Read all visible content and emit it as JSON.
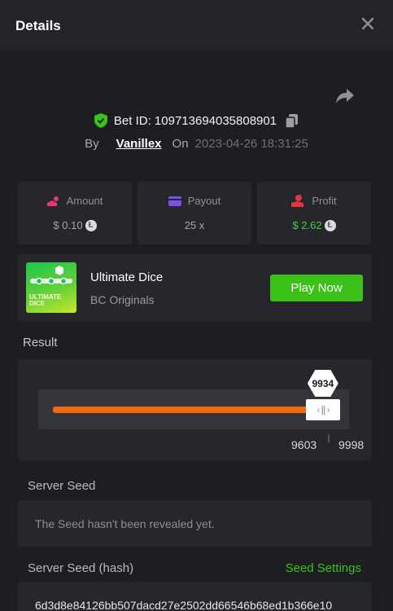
{
  "header": {
    "title": "Details"
  },
  "bet": {
    "id_label": "Bet ID:",
    "id_value": "109713694035808901",
    "by_label": "By",
    "username": "Vanillex",
    "on_label": "On",
    "timestamp": "2023-04-26 18:31:25"
  },
  "stats": {
    "amount": {
      "label": "Amount",
      "value": "$ 0.10",
      "icon": "amount-icon"
    },
    "payout": {
      "label": "Payout",
      "value": "25 x",
      "icon": "wallet-icon"
    },
    "profit": {
      "label": "Profit",
      "value": "$ 2.62",
      "icon": "profit-icon"
    }
  },
  "game": {
    "thumb_text": "ULTIMATE DICE",
    "name": "Ultimate Dice",
    "provider": "BC Originals",
    "play_label": "Play Now"
  },
  "result": {
    "label": "Result",
    "roll": "9934",
    "range_low": "9603",
    "range_high": "9998",
    "range_max": 10000,
    "fill_fraction": 0.9603
  },
  "server_seed": {
    "label": "Server Seed",
    "message": "The Seed hasn't been revealed yet.",
    "hash_label": "Server Seed (hash)",
    "settings_label": "Seed Settings",
    "hash_value": "6d3d8e84126bb507dacd27e2502dd66546b68ed1b366e10"
  },
  "colors": {
    "accent_green": "#3bc117",
    "bar_orange": "#f4690b",
    "amount_pink": "#e8356d",
    "payout_purple": "#7a4ff0",
    "profit_red": "#e2363a"
  }
}
